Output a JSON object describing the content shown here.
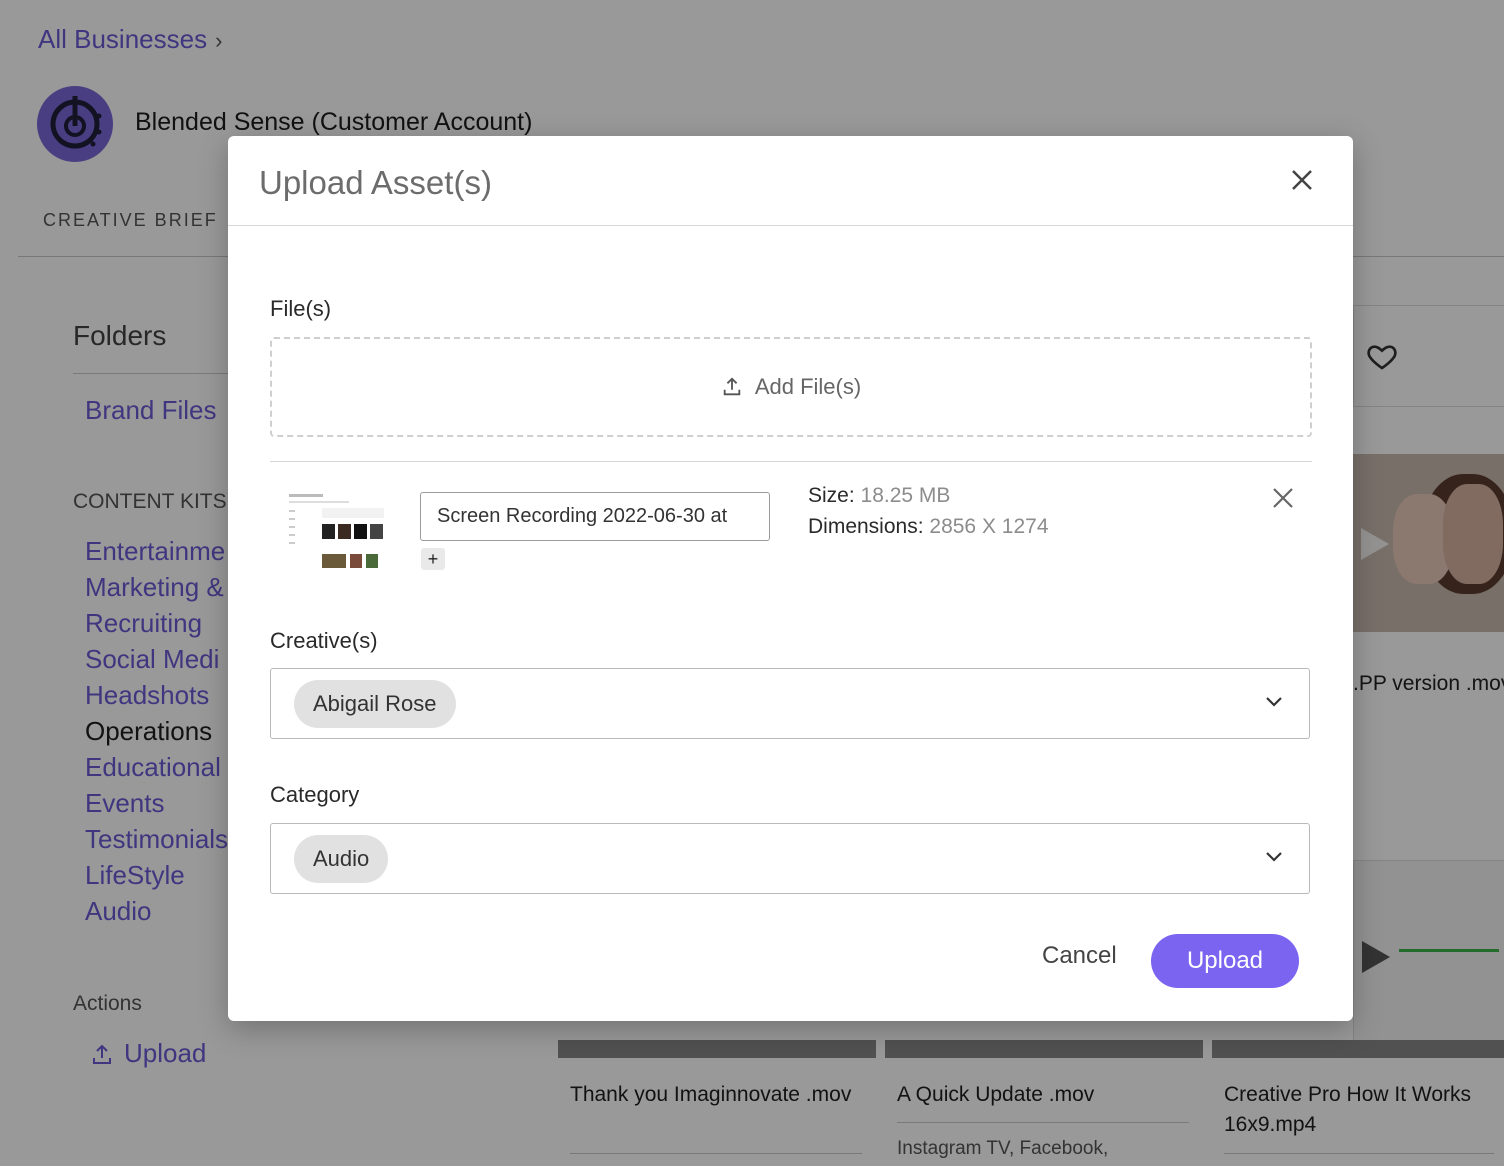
{
  "background": {
    "breadcrumb": "All Businesses",
    "business_name": "Blended Sense (Customer Account)",
    "tab_creative_brief": "CREATIVE BRIEF",
    "folders_title": "Folders",
    "brand_files": "Brand Files",
    "content_kits_label": "CONTENT KITS",
    "content_kits": [
      "Entertainme",
      "Marketing &",
      "Recruiting",
      "Social Medi",
      "Headshots",
      "Operations",
      "Educational",
      "Events",
      "Testimonials",
      "LifeStyle",
      "Audio"
    ],
    "actions_label": "Actions",
    "upload_action": "Upload",
    "right_caption": ".PP version .mov",
    "cards": [
      {
        "title": "Thank you Imaginnovate .mov",
        "sub": ""
      },
      {
        "title": "A Quick Update .mov",
        "sub": "Instagram TV, Facebook,"
      },
      {
        "title": "Creative Pro How It Works 16x9.mp4",
        "sub": ""
      }
    ]
  },
  "modal": {
    "title": "Upload Asset(s)",
    "files_label": "File(s)",
    "add_files": "Add File(s)",
    "file": {
      "name": "Screen Recording 2022-06-30 at",
      "size_label": "Size:",
      "size_value": "18.25 MB",
      "dimensions_label": "Dimensions:",
      "dimensions_value": "2856 X 1274",
      "plus": "+"
    },
    "creatives_label": "Creative(s)",
    "creative_selected": "Abigail Rose",
    "category_label": "Category",
    "category_selected": "Audio",
    "cancel": "Cancel",
    "upload": "Upload"
  },
  "colors": {
    "accent": "#7b64f0",
    "link": "#6b5bd6",
    "overlay": "rgba(0,0,0,0.40)"
  }
}
